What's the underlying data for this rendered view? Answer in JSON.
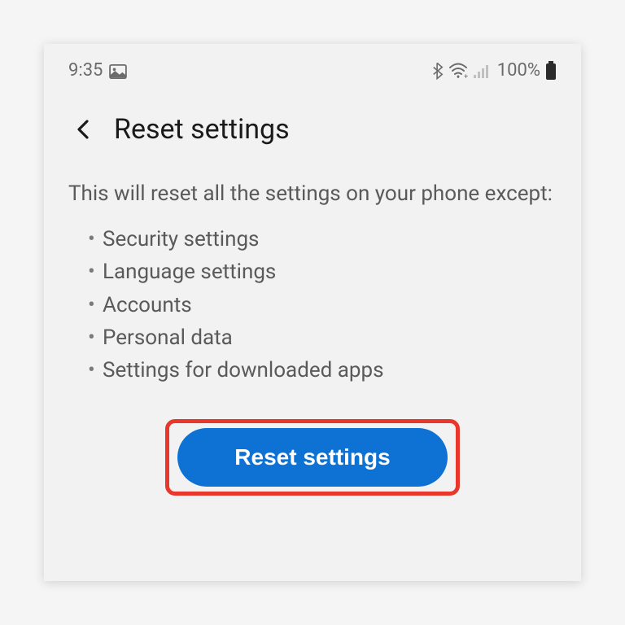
{
  "status_bar": {
    "time": "9:35",
    "battery_percent": "100%"
  },
  "header": {
    "title": "Reset settings"
  },
  "content": {
    "description": "This will reset all the settings on your phone except:",
    "exceptions": [
      "Security settings",
      "Language settings",
      "Accounts",
      "Personal data",
      "Settings for downloaded apps"
    ]
  },
  "button": {
    "label": "Reset settings"
  }
}
